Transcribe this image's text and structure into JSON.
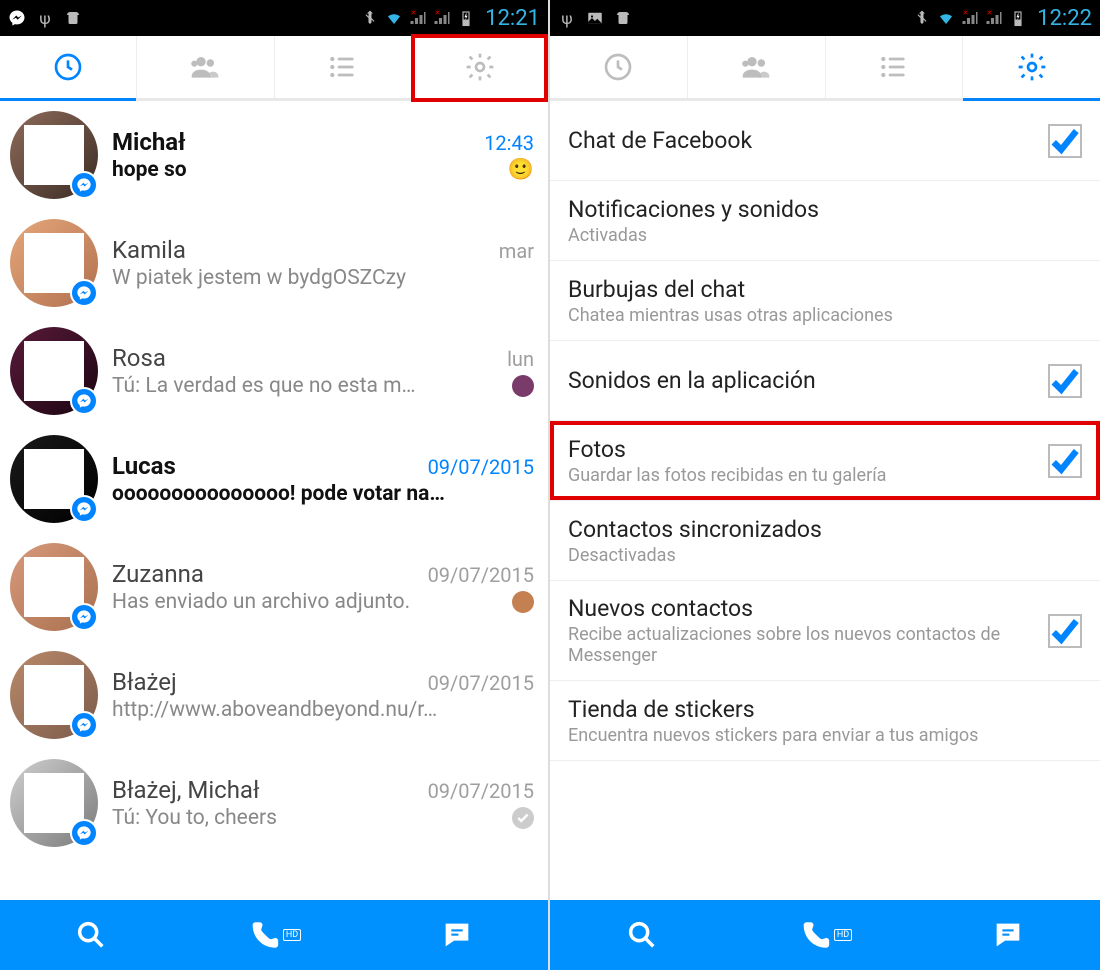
{
  "left": {
    "status_time": "12:21",
    "active_tab": 0,
    "highlight_tab": 3,
    "conversations": [
      {
        "name": "Michał",
        "time": "12:43",
        "msg": "hope so",
        "unread": true,
        "smiley": true,
        "avatar_class": "c1"
      },
      {
        "name": "Kamila",
        "time": "mar",
        "msg": "W piatek jestem w bydgOSZCzy",
        "unread": false,
        "avatar_class": "c2"
      },
      {
        "name": "Rosa",
        "time": "lun",
        "msg": "Tú: La verdad es que no esta m…",
        "unread": false,
        "trail": "#7a3a6a",
        "avatar_class": "c3"
      },
      {
        "name": "Lucas",
        "time": "09/07/2015",
        "msg": "ooooooooooooooo! pode votar na…",
        "unread": true,
        "avatar_class": "c4"
      },
      {
        "name": "Zuzanna",
        "time": "09/07/2015",
        "msg": "Has enviado un archivo adjunto.",
        "unread": false,
        "trail": "#c48050",
        "avatar_class": "c5"
      },
      {
        "name": "Błażej",
        "time": "09/07/2015",
        "msg": "http://www.aboveandbeyond.nu/r…",
        "unread": false,
        "avatar_class": "c6"
      },
      {
        "name": "Błażej, Michał",
        "time": "09/07/2015",
        "msg": "Tú: You to, cheers",
        "unread": false,
        "trail_check": true,
        "avatar_class": "c7"
      }
    ]
  },
  "right": {
    "status_time": "12:22",
    "active_tab": 3,
    "highlight_item": 4,
    "settings": [
      {
        "title": "Chat de Facebook",
        "sub": "",
        "checkbox": true,
        "checked": true
      },
      {
        "title": "Notificaciones y sonidos",
        "sub": "Activadas",
        "checkbox": false
      },
      {
        "title": "Burbujas del chat",
        "sub": "Chatea mientras usas otras aplicaciones",
        "checkbox": false
      },
      {
        "title": "Sonidos en la aplicación",
        "sub": "",
        "checkbox": true,
        "checked": true
      },
      {
        "title": "Fotos",
        "sub": "Guardar las fotos recibidas en tu galería",
        "checkbox": true,
        "checked": true
      },
      {
        "title": "Contactos sincronizados",
        "sub": "Desactivadas",
        "checkbox": false
      },
      {
        "title": "Nuevos contactos",
        "sub": "Recibe actualizaciones sobre los nuevos contactos de Messenger",
        "checkbox": true,
        "checked": true
      },
      {
        "title": "Tienda de stickers",
        "sub": "Encuentra nuevos stickers para enviar a tus amigos",
        "checkbox": false
      }
    ]
  },
  "icons": {
    "clock": "clock",
    "people": "people",
    "list": "list",
    "gear": "gear"
  }
}
